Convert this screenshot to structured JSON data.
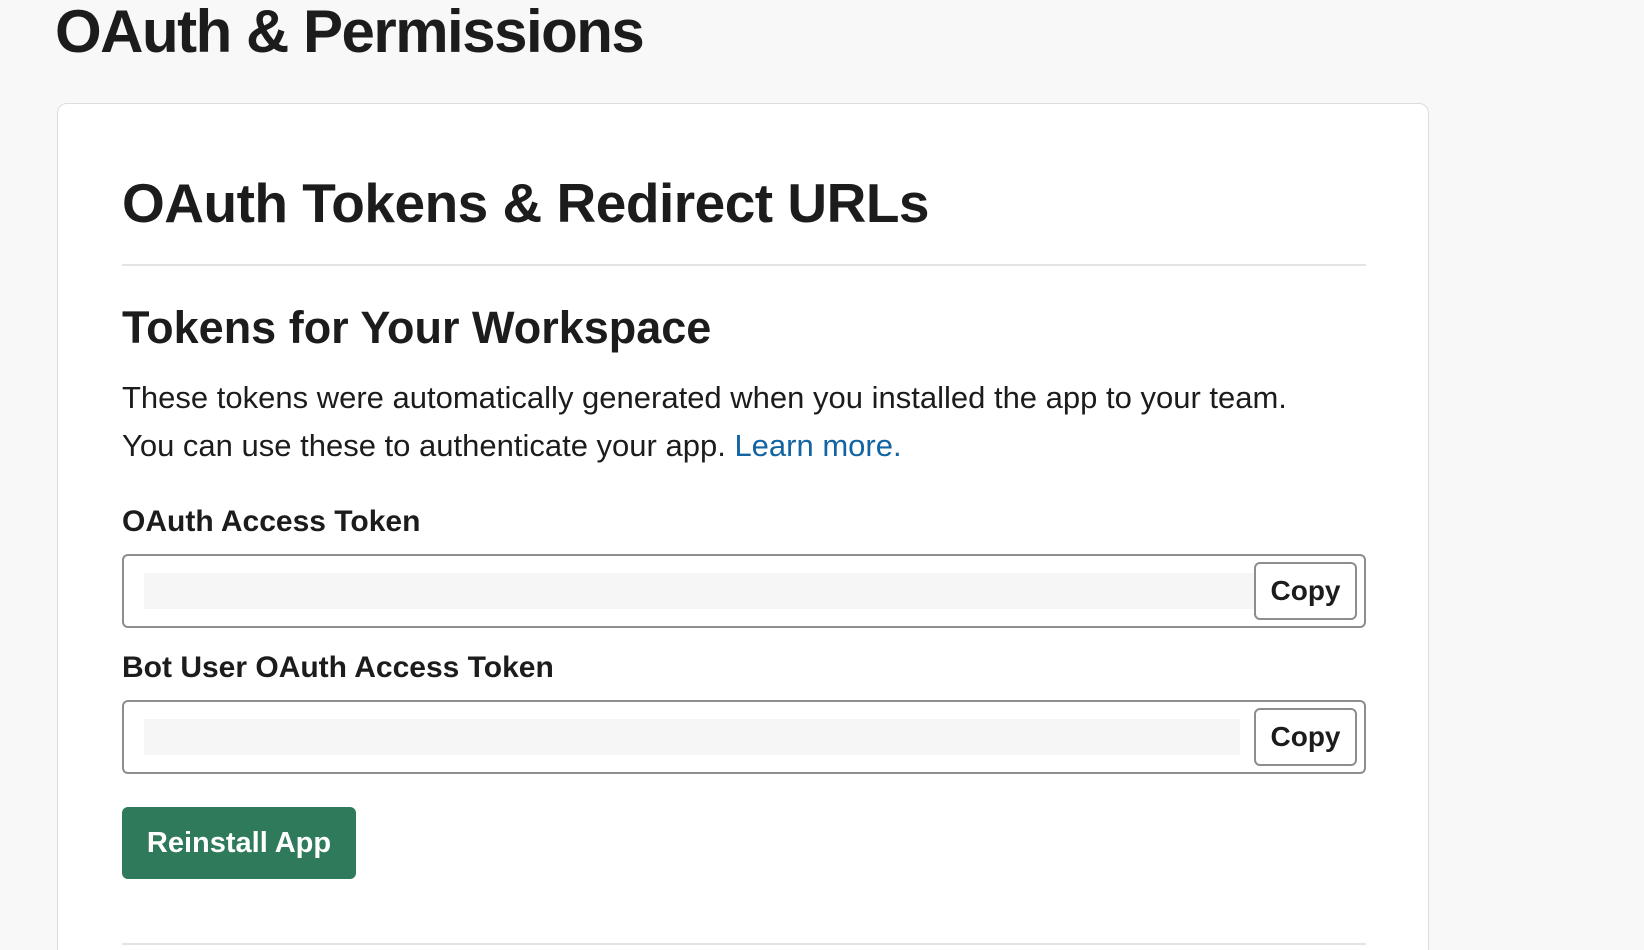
{
  "page": {
    "title": "OAuth & Permissions"
  },
  "card": {
    "title": "OAuth Tokens & Redirect URLs",
    "section_title": "Tokens for Your Workspace",
    "description_line1": "These tokens were automatically generated when you installed the app to your team.",
    "description_line2": "You can use these to authenticate your app.",
    "learn_more": "Learn more."
  },
  "oauth_token": {
    "label": "OAuth Access Token",
    "value": "",
    "copy_label": "Copy"
  },
  "bot_token": {
    "label": "Bot User OAuth Access Token",
    "value": "",
    "copy_label": "Copy"
  },
  "reinstall_label": "Reinstall App",
  "colors": {
    "page_background": "#f8f8f8",
    "link": "#1264a3",
    "primary_button": "#2f7a5a"
  }
}
